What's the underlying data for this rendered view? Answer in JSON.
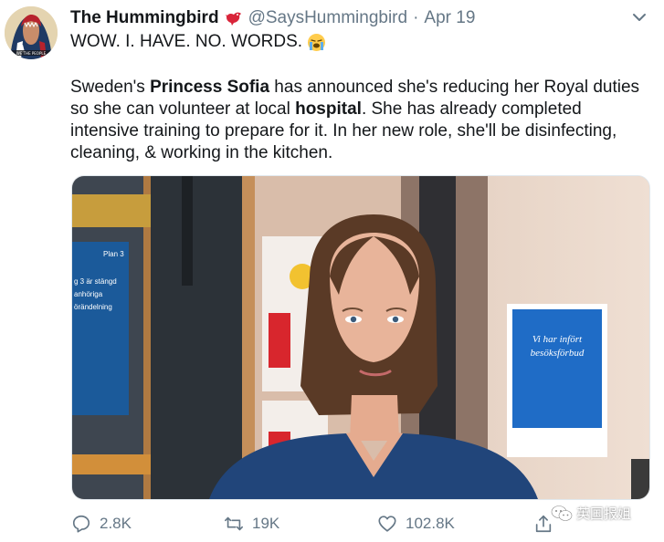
{
  "tweet": {
    "display_name": "The Hummingbird",
    "handle": "@SaysHummingbird",
    "separator": "·",
    "date": "Apr 19",
    "headline": "WOW. I. HAVE. NO. WORDS.",
    "body": {
      "p1": "Sweden's ",
      "bold1": "Princess Sofia",
      "p2": " has announced she's reducing her Royal duties so she can volunteer at local ",
      "bold2": "hospital",
      "p3": ". She has already completed intensive training to prepare for it. In her new role, she'll be disinfecting, cleaning, & working in the kitchen."
    },
    "photo_text": {
      "sign_left_title": "Plan 3",
      "sign_left_line1": "g 3 är stängd",
      "sign_left_line2": "anhöriga",
      "sign_left_line3": "örändelning",
      "sign_right_line1": "Vi har infört",
      "sign_right_line2": "besöksförbud"
    },
    "counts": {
      "replies": "2.8K",
      "retweets": "19K",
      "likes": "102.8K"
    },
    "watermark": "英国报姐"
  },
  "icons": {
    "avatar": "avatar-portrait",
    "bird": "bird-emoji",
    "cry": "loudly-crying-face-emoji",
    "caret": "chevron-down-icon",
    "reply": "reply-icon",
    "retweet": "retweet-icon",
    "like": "heart-icon",
    "share": "share-icon"
  },
  "colors": {
    "text": "#14171a",
    "secondary": "#657786",
    "bird_red": "#d9253a",
    "border": "#e1e8ed"
  }
}
